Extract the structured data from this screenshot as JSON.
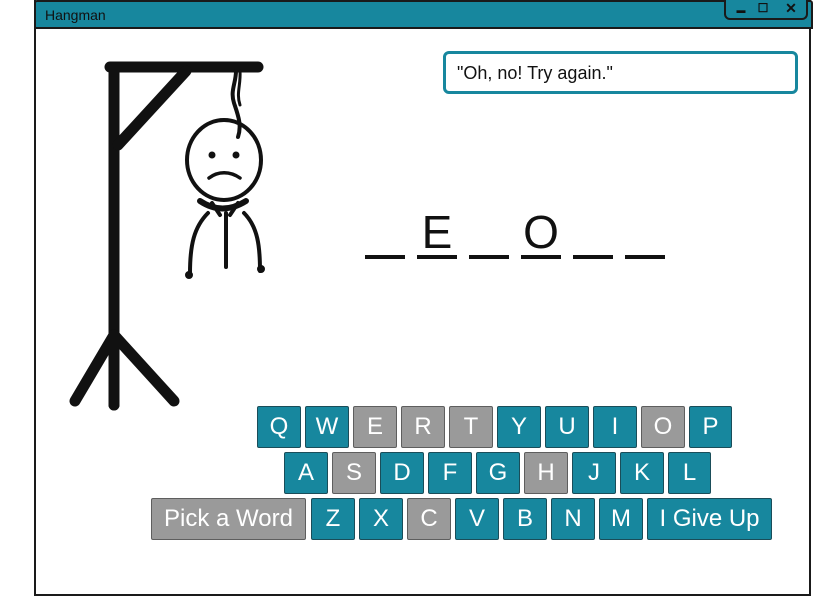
{
  "window": {
    "title": "Hangman",
    "minimize": "▬",
    "maximize": "☐",
    "close": "✕"
  },
  "message": "\"Oh, no! Try again.\"",
  "word": [
    "",
    "E",
    "",
    "O",
    "",
    ""
  ],
  "keyboard": {
    "row1": [
      {
        "label": "Q",
        "used": false
      },
      {
        "label": "W",
        "used": false
      },
      {
        "label": "E",
        "used": true
      },
      {
        "label": "R",
        "used": true
      },
      {
        "label": "T",
        "used": true
      },
      {
        "label": "Y",
        "used": false
      },
      {
        "label": "U",
        "used": false
      },
      {
        "label": "I",
        "used": false
      },
      {
        "label": "O",
        "used": true
      },
      {
        "label": "P",
        "used": false
      }
    ],
    "row2": [
      {
        "label": "A",
        "used": false
      },
      {
        "label": "S",
        "used": true
      },
      {
        "label": "D",
        "used": false
      },
      {
        "label": "F",
        "used": false
      },
      {
        "label": "G",
        "used": false
      },
      {
        "label": "H",
        "used": true
      },
      {
        "label": "J",
        "used": false
      },
      {
        "label": "K",
        "used": false
      },
      {
        "label": "L",
        "used": false
      }
    ],
    "row3": [
      {
        "label": "Z",
        "used": false
      },
      {
        "label": "X",
        "used": false
      },
      {
        "label": "C",
        "used": true
      },
      {
        "label": "V",
        "used": false
      },
      {
        "label": "B",
        "used": false
      },
      {
        "label": "N",
        "used": false
      },
      {
        "label": "M",
        "used": false
      }
    ],
    "pick_word": "Pick a Word",
    "give_up": "I Give Up"
  },
  "colors": {
    "accent": "#17879e",
    "used": "#9a9a9a"
  }
}
